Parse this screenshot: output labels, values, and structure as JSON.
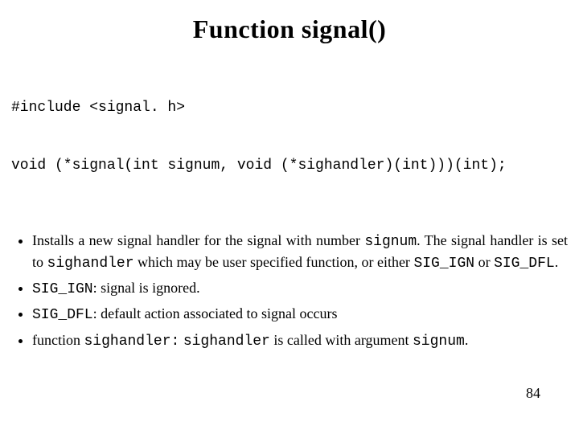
{
  "title": "Function signal()",
  "code": {
    "line1": "#include <signal. h>",
    "line2": "void (*signal(int signum, void (*sighandler)(int)))(int);"
  },
  "bullet1": {
    "pre": "Installs a new signal handler for the signal with number ",
    "c1": "signum",
    "mid1": ".  The signal handler is set to ",
    "c2": "sighandler",
    "mid2": "  which  may  be  user specified function, or either ",
    "c3": "SIG_IGN",
    "mid3": "  or ",
    "c4": "SIG_DFL",
    "tail": "."
  },
  "bullet2": {
    "c1": "SIG_IGN",
    "text": ": signal is  ignored."
  },
  "bullet3": {
    "c1": "SIG_DFL",
    "text": ": default action associated to signal occurs"
  },
  "bullet4": {
    "pre": "function ",
    "c1": "sighandler:",
    "mid1": "  ",
    "c2": "sighandler",
    "mid2": " is called with argument ",
    "c3": "signum",
    "tail": "."
  },
  "page_number": "84"
}
